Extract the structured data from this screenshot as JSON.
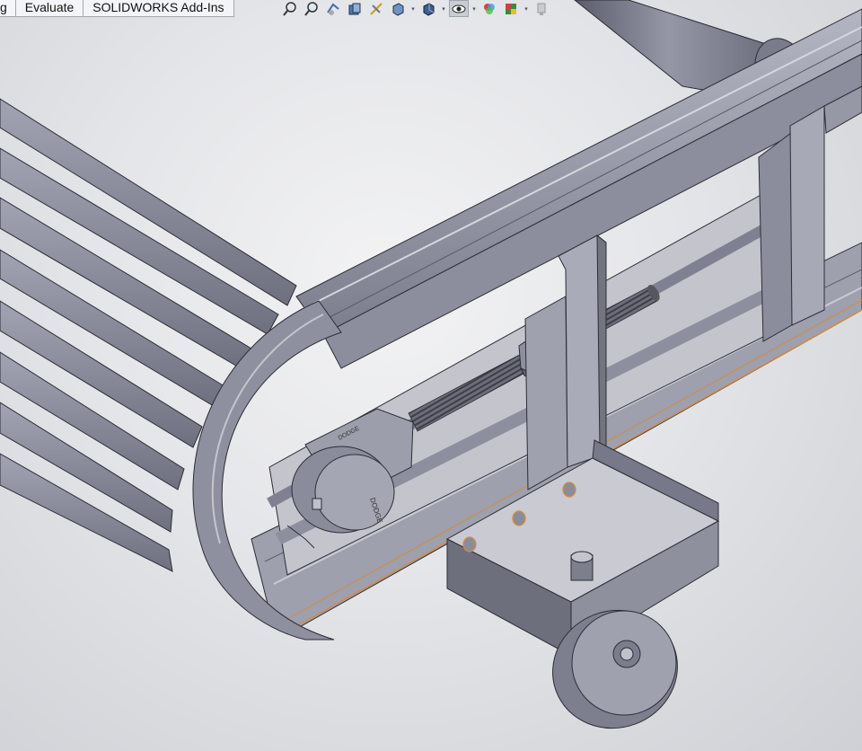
{
  "tabs": [
    {
      "label": "g"
    },
    {
      "label": "Evaluate"
    },
    {
      "label": "SOLIDWORKS Add-Ins"
    }
  ],
  "heads_up_toolbar": [
    {
      "icon": "zoom-to-fit-icon"
    },
    {
      "icon": "zoom-to-area-icon"
    },
    {
      "icon": "previous-view-icon"
    },
    {
      "icon": "section-view-icon"
    },
    {
      "icon": "dynamic-annotation-views-icon"
    },
    {
      "icon": "view-orientation-icon"
    },
    {
      "icon": "display-style-icon"
    },
    {
      "icon": "hide-show-items-icon"
    },
    {
      "icon": "edit-appearance-icon"
    },
    {
      "icon": "apply-scene-icon"
    },
    {
      "icon": "view-settings-icon"
    }
  ],
  "colors": {
    "model_face_light": "#9a9cab",
    "model_face_mid": "#7f8192",
    "model_face_dark": "#5d5f6e",
    "edge": "#2c2d36",
    "highlight_edge": "#d98a3a",
    "viewport_center": "#f3f3f4",
    "viewport_edge": "#cfd0d5"
  },
  "model_markings": {
    "bearing_text_1": "DODGE",
    "bearing_text_2": "DODGE"
  }
}
